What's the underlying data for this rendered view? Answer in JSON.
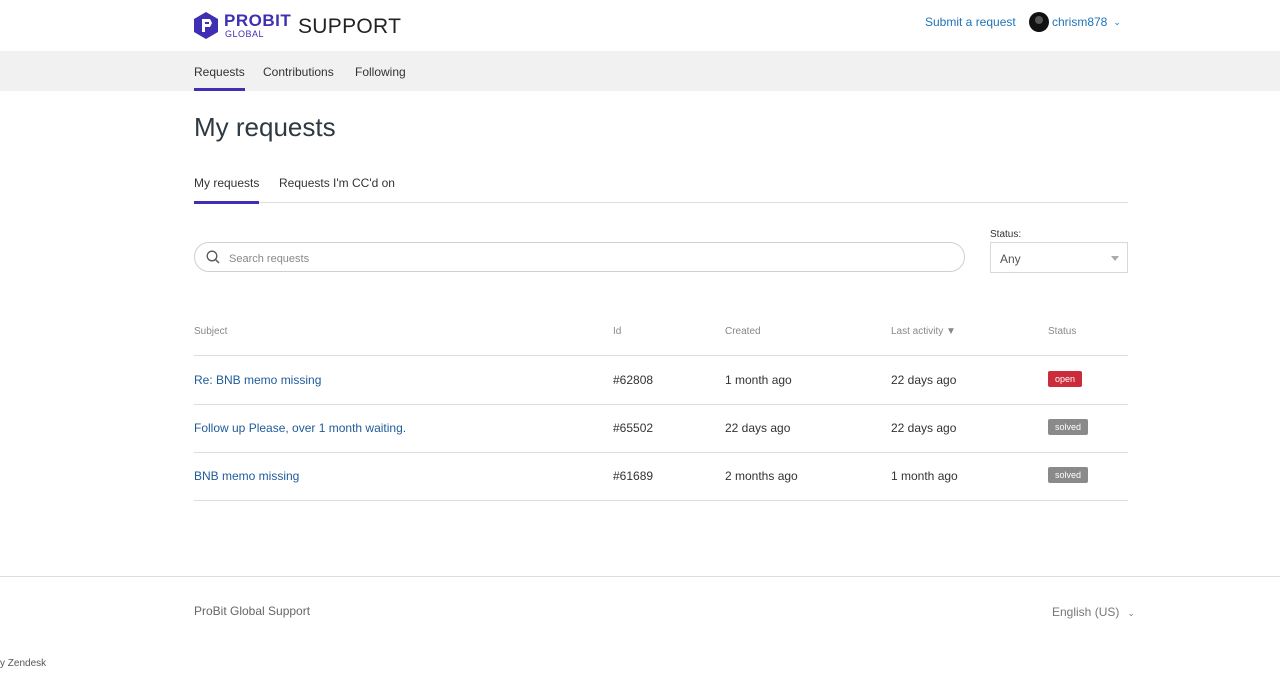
{
  "header": {
    "brand": "PROBIT",
    "brand_sub": "GLOBAL",
    "support": "SUPPORT",
    "submit_link": "Submit a request",
    "username": "chrism878",
    "accent_color": "#3f2fb3"
  },
  "subnav": {
    "items": [
      "Requests",
      "Contributions",
      "Following"
    ],
    "active": "Requests"
  },
  "page_title": "My requests",
  "tabs": {
    "items": [
      "My requests",
      "Requests I'm CC'd on"
    ],
    "active": "My requests"
  },
  "search": {
    "placeholder": "Search requests",
    "value": ""
  },
  "status_filter": {
    "label": "Status:",
    "selected": "Any"
  },
  "table": {
    "columns": [
      "Subject",
      "Id",
      "Created",
      "Last activity",
      "Status"
    ],
    "sort_indicator": "▼",
    "rows": [
      {
        "subject": "Re: BNB memo missing",
        "id": "#62808",
        "created": "1 month ago",
        "last_activity": "22 days ago",
        "status": "open"
      },
      {
        "subject": "Follow up Please, over 1 month waiting.",
        "id": "#65502",
        "created": "22 days ago",
        "last_activity": "22 days ago",
        "status": "solved"
      },
      {
        "subject": "BNB memo missing",
        "id": "#61689",
        "created": "2 months ago",
        "last_activity": "1 month ago",
        "status": "solved"
      }
    ],
    "status_colors": {
      "open": "#cc2b3b",
      "solved": "#8a8a8a"
    }
  },
  "footer": {
    "name": "ProBit Global Support",
    "language": "English (US)",
    "powered": "y Zendesk"
  },
  "icons": {
    "logo": "probit-logo-icon",
    "search": "search-icon",
    "user_chevron": "chevron-down-icon",
    "lang_chevron": "chevron-down-icon",
    "select_caret": "caret-down-icon"
  }
}
